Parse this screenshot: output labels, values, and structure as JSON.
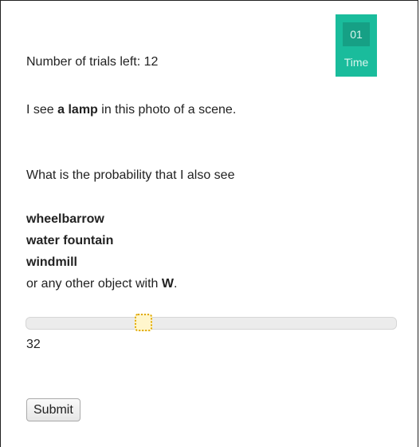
{
  "timer": {
    "count": "01",
    "label": "Time"
  },
  "trials": {
    "text": "Number of trials left: 12"
  },
  "statement": {
    "prefix": "I see ",
    "object": "a lamp",
    "suffix": " in this photo of a scene."
  },
  "question": {
    "text": "What is the probability that I also see"
  },
  "objects": [
    "wheelbarrow",
    "water fountain",
    "windmill"
  ],
  "other": {
    "prefix": "or any other object with ",
    "letter": "W",
    "suffix": "."
  },
  "slider": {
    "value": "32",
    "min": 0,
    "max": 100
  },
  "submit": {
    "label": "Submit"
  },
  "colors": {
    "timer_bg": "#1abc9c",
    "timer_box": "#16a085",
    "slider_handle_border": "#e0a800"
  }
}
